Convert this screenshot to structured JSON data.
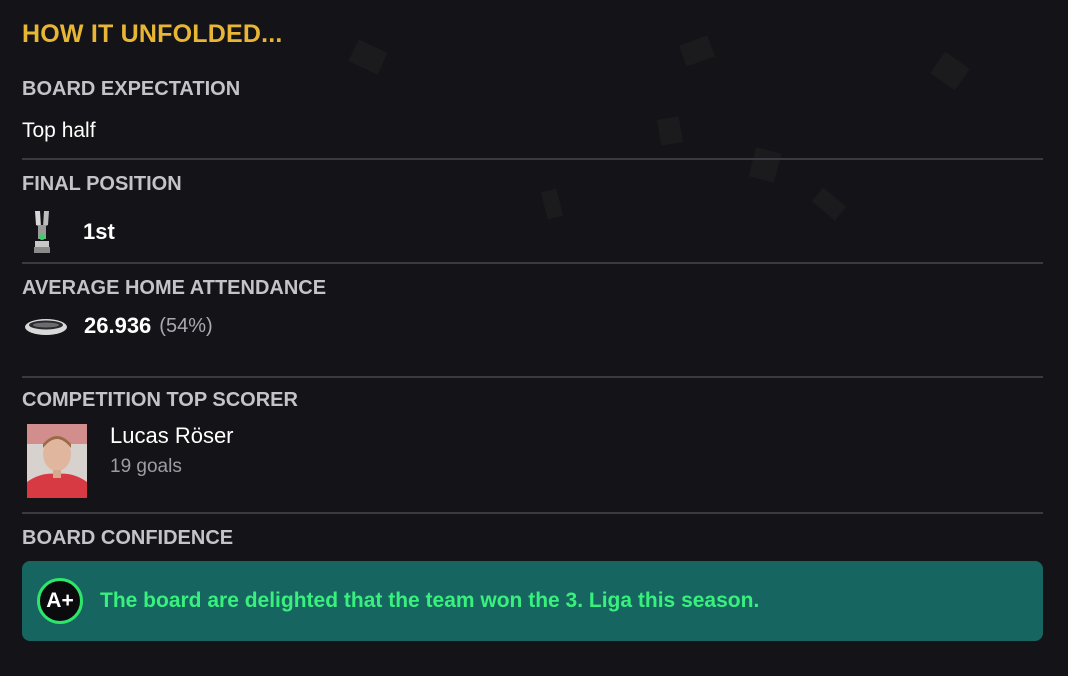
{
  "title": "HOW IT UNFOLDED...",
  "board_expectation": {
    "label": "BOARD EXPECTATION",
    "value": "Top half"
  },
  "final_position": {
    "label": "FINAL POSITION",
    "value": "1st",
    "icon": "trophy-icon"
  },
  "attendance": {
    "label": "AVERAGE HOME ATTENDANCE",
    "value": "26.936",
    "percent": "(54%)",
    "icon": "stadium-icon"
  },
  "top_scorer": {
    "label": "COMPETITION TOP SCORER",
    "name": "Lucas Röser",
    "goals": "19 goals"
  },
  "board_confidence": {
    "label": "BOARD CONFIDENCE",
    "grade": "A+",
    "message": "The board are delighted that the team won the 3. Liga this season."
  },
  "colors": {
    "background": "#141418",
    "title": "#e8b634",
    "label": "#c3c3c8",
    "confidence_bg": "#176561",
    "confidence_text": "#38f07c",
    "grade_ring": "#2ee66a"
  }
}
